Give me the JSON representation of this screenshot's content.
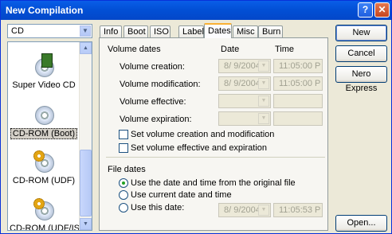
{
  "window": {
    "title": "New Compilation",
    "help_glyph": "?",
    "close_glyph": "✕"
  },
  "media_combo": {
    "value": "CD",
    "arrow": "▼"
  },
  "compilation_list": {
    "items": [
      {
        "label": "Super Video CD",
        "icon": "video-disc-icon",
        "selected": false
      },
      {
        "label": "CD-ROM (Boot)",
        "icon": "boot-disc-icon",
        "selected": true
      },
      {
        "label": "CD-ROM (UDF)",
        "icon": "udf-disc-icon",
        "selected": false
      },
      {
        "label": "CD-ROM (UDF/ISO)",
        "icon": "udf-iso-disc-icon",
        "selected": false
      }
    ],
    "scroll_up": "▲",
    "scroll_down": "▼"
  },
  "tabs": [
    "Info",
    "Boot",
    "ISO",
    "Label",
    "Dates",
    "Misc",
    "Burn"
  ],
  "active_tab": "Dates",
  "dates": {
    "volume_dates_label": "Volume dates",
    "date_header": "Date",
    "time_header": "Time",
    "rows": [
      {
        "label": "Volume creation:",
        "date": "8/ 9/2004",
        "time": "11:05:00 P"
      },
      {
        "label": "Volume modification:",
        "date": "8/ 9/2004",
        "time": "11:05:00 P"
      },
      {
        "label": "Volume effective:",
        "date": "",
        "time": ""
      },
      {
        "label": "Volume expiration:",
        "date": "",
        "time": ""
      }
    ],
    "check_creation_mod": "Set volume creation and modification",
    "check_effective_exp": "Set volume effective and expiration",
    "file_dates_label": "File dates",
    "radio_original": "Use the date and time from the original file",
    "radio_current": "Use current date and time",
    "radio_this_date": "Use this date:",
    "this_date": "8/ 9/2004",
    "this_time": "11:05:53 P",
    "dropdown_arrow": "▼"
  },
  "buttons": {
    "new": "New",
    "cancel": "Cancel",
    "nero_express": "Nero Express",
    "open": "Open..."
  }
}
